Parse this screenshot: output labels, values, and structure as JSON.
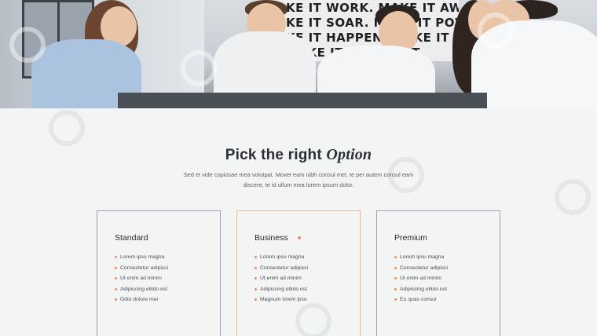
{
  "hero": {
    "poster_lines": [
      "KE IT WORK. MAKE IT AWESOME.",
      "KE IT SOAR. MAKE IT POWERFUL.",
      "KE IT HAPPEN. MAKE IT SIMPLE.",
      "MAKE IT BRILLIANT."
    ]
  },
  "section": {
    "title_plain": "Pick the right ",
    "title_italic": "Option",
    "description": "Sed et vide copiosae mea volutpat. Movet eam nibh consul mel, te per autem consul eam discere, te id ullum mea lorem ipsum dolor."
  },
  "plans": [
    {
      "name": "Standard",
      "featured": false,
      "features": [
        "Lorem ipsu magna",
        "Consectetur adipisci",
        "Ut enim ad minim",
        "Adipiscing elitdo est",
        "Odio dolore mei"
      ]
    },
    {
      "name": "Business",
      "featured": true,
      "features": [
        "Lorem ipsu magna",
        "Consectetur adipisci",
        "Ut enim ad minim",
        "Adipiscing elitdo est",
        "Magnum lorem ipsu"
      ]
    },
    {
      "name": "Premium",
      "featured": false,
      "features": [
        "Lorem ipsu magna",
        "Consectetur adipisci",
        "Ut enim ad minim",
        "Adipiscing elitdo est",
        "Eu quas consul"
      ]
    }
  ],
  "colors": {
    "accent": "#f08a55",
    "card_border": "#9aa3b4",
    "featured_border": "#f0b48e",
    "background": "#f3f4f4"
  }
}
